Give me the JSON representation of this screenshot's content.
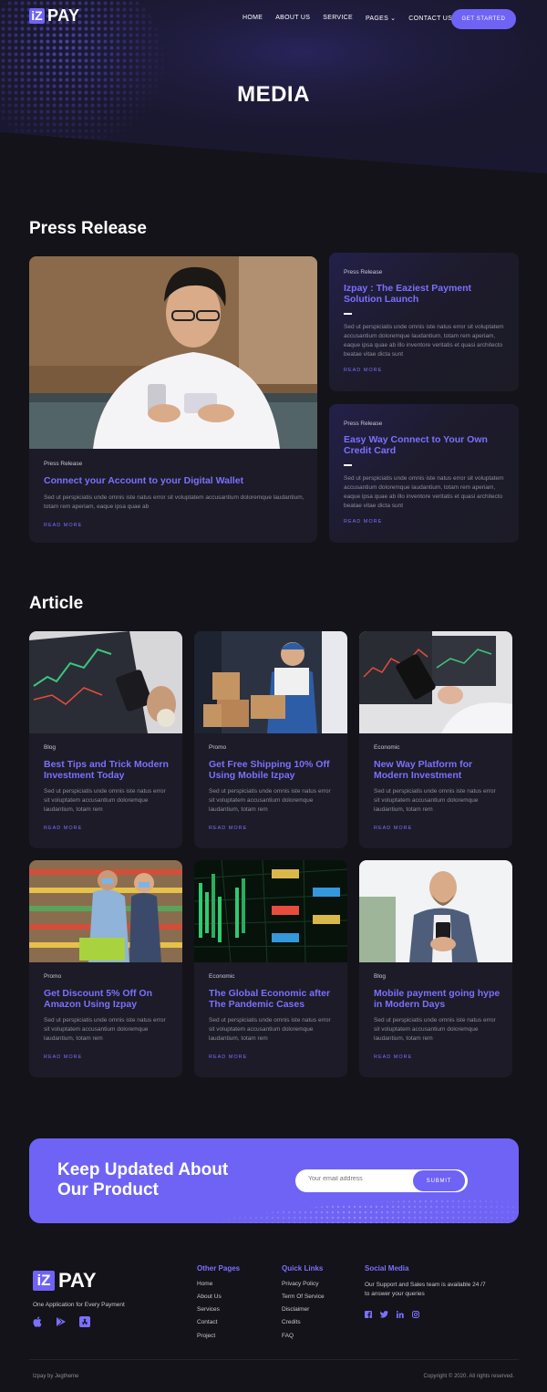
{
  "brand": {
    "logo_box": "iZ",
    "logo_text": "PAY"
  },
  "nav": {
    "items": [
      "HOME",
      "ABOUT US",
      "SERVICE",
      "PAGES",
      "CONTACT US"
    ],
    "cta": "GET STARTED"
  },
  "hero": {
    "title": "MEDIA"
  },
  "press": {
    "heading": "Press Release",
    "featured": {
      "category": "Press Release",
      "title": "Connect your Account to your Digital Wallet",
      "desc": "Sed ut perspiciatis unde omnis iste natus error sit voluptatem accusantium doloremque laudantium, totam rem aperiam, eaque ipsa quae ab",
      "more": "READ MORE"
    },
    "side": [
      {
        "category": "Press Release",
        "title": "Izpay : The Eaziest Payment Solution Launch",
        "desc": "Sed ut perspiciatis unde omnis iste natus error sit voluptatem accusantium doloremque laudantium, totam rem aperiam, eaque ipsa quae ab illo inventore veritatis et quasi architecto beatae vitae dicta sunt",
        "more": "READ MORE"
      },
      {
        "category": "Press Release",
        "title": "Easy Way Connect to Your Own Credit Card",
        "desc": "Sed ut perspiciatis unde omnis iste natus error sit voluptatem accusantium doloremque laudantium, totam rem aperiam, eaque ipsa quae ab illo inventore veritatis et quasi architecto beatae vitae dicta sunt",
        "more": "READ MORE"
      }
    ]
  },
  "article": {
    "heading": "Article",
    "cards": [
      {
        "category": "Blog",
        "title": "Best Tips and Trick Modern Investment Today",
        "desc": "Sed ut perspiciatis unde omnis iste natus error sit voluptatem accusantium doloremque laudantium, totam rem",
        "more": "READ MORE"
      },
      {
        "category": "Promo",
        "title": "Get Free Shipping 10% Off Using Mobile Izpay",
        "desc": "Sed ut perspiciatis unde omnis iste natus error sit voluptatem accusantium doloremque laudantium, totam rem",
        "more": "READ MORE"
      },
      {
        "category": "Economic",
        "title": "New Way Platform for Modern Investment",
        "desc": "Sed ut perspiciatis unde omnis iste natus error sit voluptatem accusantium doloremque laudantium, totam rem",
        "more": "READ MORE"
      },
      {
        "category": "Promo",
        "title": "Get Discount 5% Off On Amazon Using Izpay",
        "desc": "Sed ut perspiciatis unde omnis iste natus error sit voluptatem accusantium doloremque laudantium, totam rem",
        "more": "READ MORE"
      },
      {
        "category": "Economic",
        "title": "The Global Economic after The Pandemic Cases",
        "desc": "Sed ut perspiciatis unde omnis iste natus error sit voluptatem accusantium doloremque laudantium, totam rem",
        "more": "READ MORE"
      },
      {
        "category": "Blog",
        "title": "Mobile payment going hype in Modern Days",
        "desc": "Sed ut perspiciatis unde omnis iste natus error sit voluptatem accusantium doloremque laudantium, totam rem",
        "more": "READ MORE"
      }
    ]
  },
  "newsletter": {
    "title_line1": "Keep Updated About",
    "title_line2": "Our Product",
    "placeholder": "Your email address",
    "submit": "SUBMIT"
  },
  "footer": {
    "tagline": "One Application for Every Payment",
    "other_pages": {
      "title": "Other Pages",
      "links": [
        "Home",
        "About Us",
        "Services",
        "Contact",
        "Project"
      ]
    },
    "quick_links": {
      "title": "Quick Links",
      "links": [
        "Privacy Policy",
        "Term Of Service",
        "Disclaimer",
        "Credits",
        "FAQ"
      ]
    },
    "social": {
      "title": "Social Media",
      "text": "Our Support and Sales team is available 24 /7 to answer your queries"
    },
    "credit": "Izpay by Jegtheme",
    "copyright": "Copyright © 2020. All rights reserved."
  },
  "colors": {
    "accent": "#6f63f5",
    "accent_text": "#7c70ff",
    "background": "#131319",
    "card": "#1c1b27"
  },
  "icons": [
    "chevron-down-icon",
    "apple-icon",
    "google-play-icon",
    "app-store-icon",
    "facebook-icon",
    "twitter-icon",
    "linkedin-icon",
    "instagram-icon"
  ]
}
